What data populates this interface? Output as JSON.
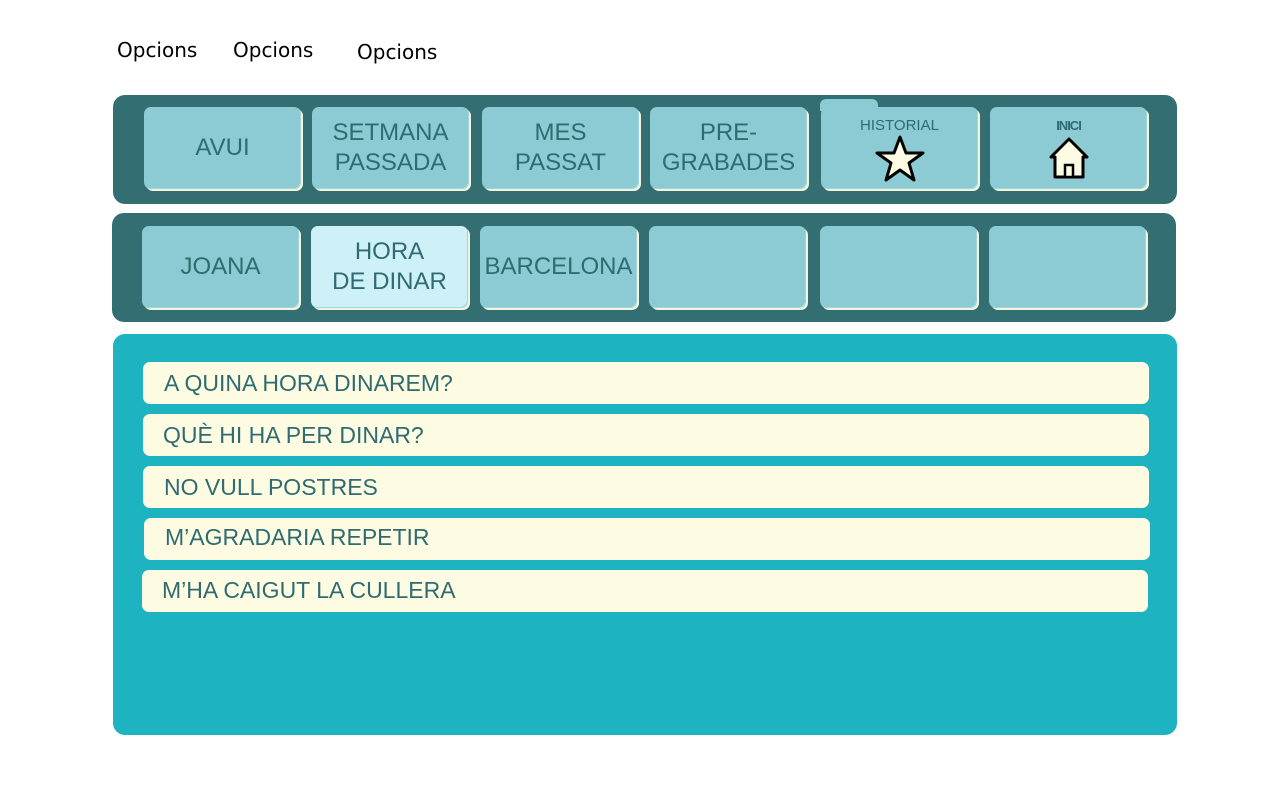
{
  "options_menu": [
    "Opcions",
    "Opcions",
    "Opcions"
  ],
  "categories_row": {
    "tiles": [
      {
        "label": "AVUI"
      },
      {
        "label": "SETMANA\nPASSADA"
      },
      {
        "label": "MES\nPASSAT"
      },
      {
        "label": "PRE-\nGRABADES"
      },
      {
        "label": "HISTORIAL",
        "icon": "star-icon"
      },
      {
        "label": "INICI",
        "icon": "home-icon"
      }
    ]
  },
  "topics_row": {
    "tiles": [
      {
        "label": "JOANA"
      },
      {
        "label": "HORA\nDE DINAR",
        "selected": true
      },
      {
        "label": "BARCELONA"
      },
      {
        "label": ""
      },
      {
        "label": ""
      },
      {
        "label": ""
      }
    ]
  },
  "phrases": [
    "A QUINA HORA DINAREM?",
    "QUÈ HI HA PER DINAR?",
    "NO VULL POSTRES",
    "M’AGRADARIA REPETIR",
    "M’HA CAIGUT LA CULLERA"
  ],
  "colors": {
    "panel": "#336e73",
    "tile": "#8ccbd4",
    "tile_selected": "#cdf1f6",
    "phrase_area": "#1eb3c0",
    "phrase_bg": "#fdfce3",
    "text": "#2f6b70"
  }
}
